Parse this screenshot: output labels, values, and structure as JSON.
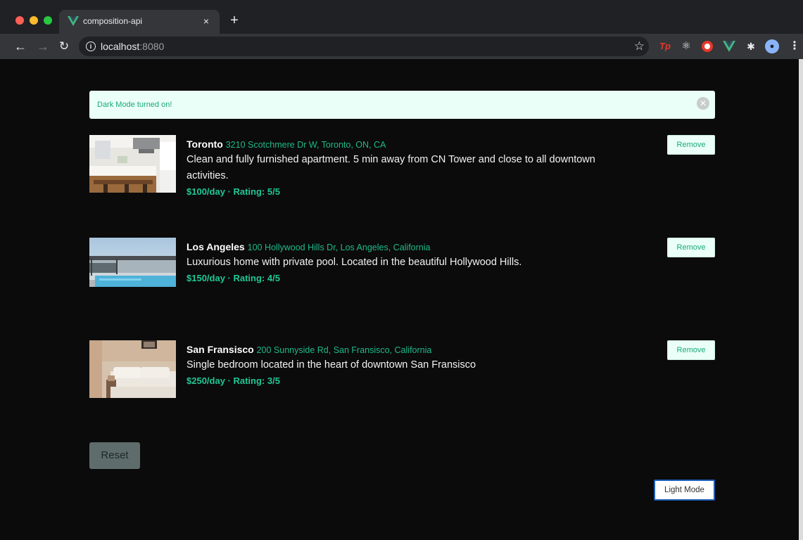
{
  "browser": {
    "tab_title": "composition-api",
    "tab_close": "×",
    "new_tab": "+",
    "url_host": "localhost",
    "url_port": ":8080",
    "icons": [
      "back-arrow-icon",
      "forward-arrow-icon",
      "reload-icon",
      "info-icon",
      "star-icon",
      "extensions"
    ]
  },
  "alert": {
    "message": "Dark Mode turned on!",
    "close_icon": "✕"
  },
  "listings": [
    {
      "city": "Toronto",
      "address": "3210 Scotchmere Dr W, Toronto, ON, CA",
      "description": "Clean and fully furnished apartment. 5 min away from CN Tower and close to all downtown activities.",
      "meta": "$100/day · Rating: 5/5",
      "remove_label": "Remove"
    },
    {
      "city": "Los Angeles",
      "address": "100 Hollywood Hills Dr, Los Angeles, California",
      "description": "Luxurious home with private pool. Located in the beautiful Hollywood Hills.",
      "meta": "$150/day · Rating: 4/5",
      "remove_label": "Remove"
    },
    {
      "city": "San Fransisco",
      "address": "200 Sunnyside Rd, San Fransisco, California",
      "description": "Single bedroom located in the heart of downtown San Fransisco",
      "meta": "$250/day · Rating: 3/5",
      "remove_label": "Remove"
    }
  ],
  "reset_label": "Reset",
  "mode_toggle_label": "Light Mode",
  "colors": {
    "accent": "#1fb98a",
    "alert_bg": "#eafff8",
    "page_bg": "#0b0b0b"
  }
}
